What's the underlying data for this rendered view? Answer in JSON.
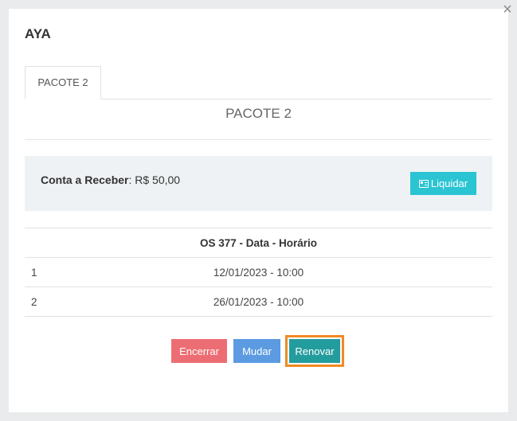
{
  "modal": {
    "title": "AYA",
    "close_icon": "×"
  },
  "tabs": [
    {
      "label": "PACOTE 2",
      "active": true
    }
  ],
  "pane": {
    "title": "PACOTE 2"
  },
  "receivable": {
    "label": "Conta a Receber",
    "separator": ":",
    "value": "R$ 50,00",
    "liquidar_label": "Liquidar",
    "liquidar_icon": "id-card-icon"
  },
  "table": {
    "header": "OS 377 - Data - Horário",
    "rows": [
      {
        "index": "1",
        "datetime": "12/01/2023 - 10:00"
      },
      {
        "index": "2",
        "datetime": "26/01/2023 - 10:00"
      }
    ]
  },
  "actions": {
    "encerrar": "Encerrar",
    "mudar": "Mudar",
    "renovar": "Renovar"
  },
  "colors": {
    "liquidar": "#2ac4d3",
    "encerrar": "#ec6e74",
    "mudar": "#5c9be1",
    "renovar": "#239c9e",
    "highlight": "#f08a24"
  }
}
